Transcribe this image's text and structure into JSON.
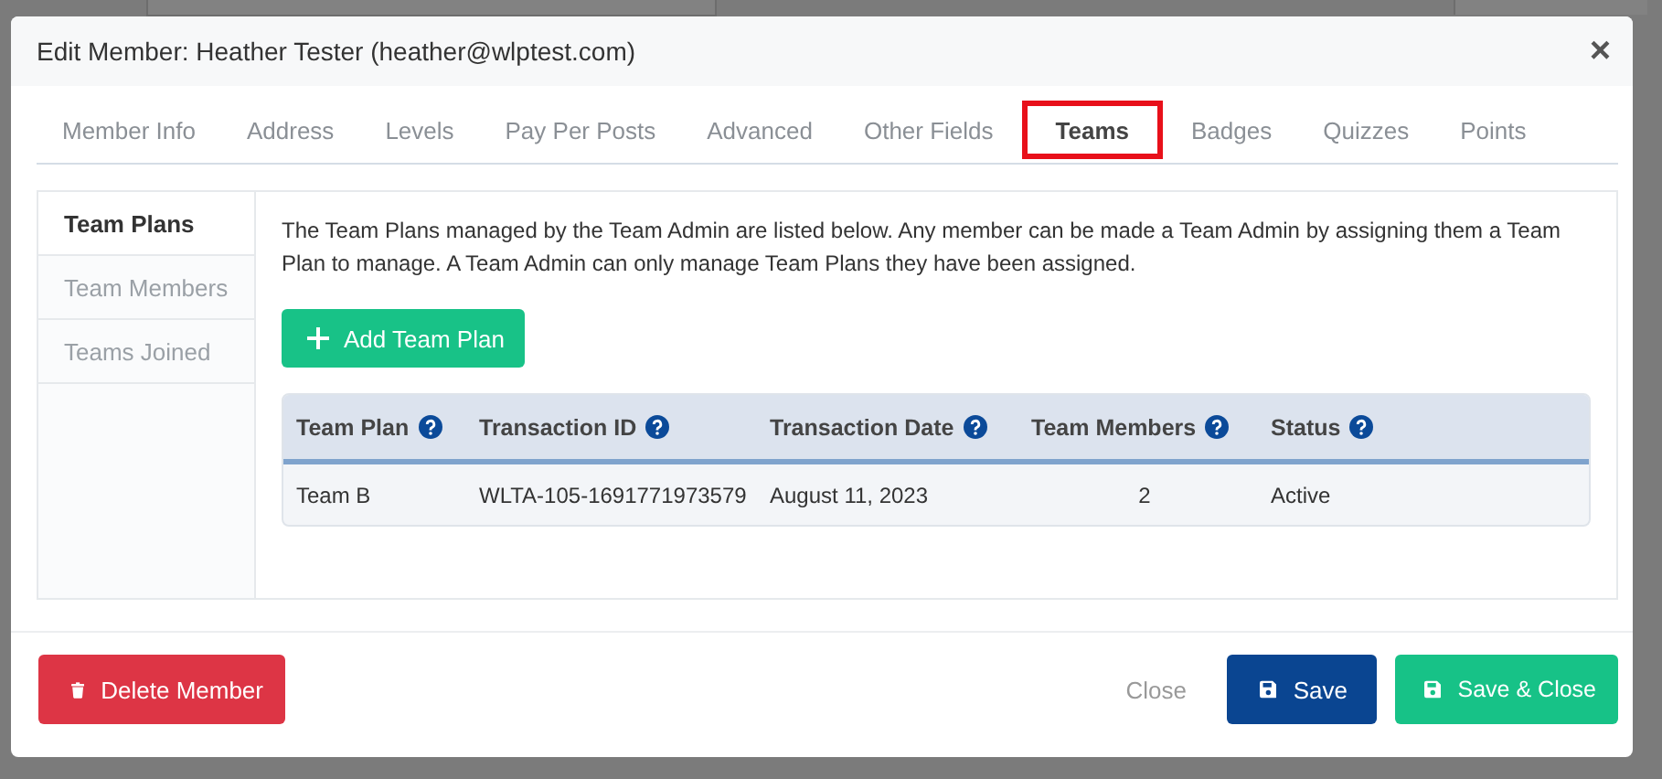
{
  "window": {
    "title": "Edit Member: Heather Tester (heather@wlptest.com)",
    "close": "×"
  },
  "tabs": [
    {
      "label": "Member Info",
      "selected": false,
      "highlighted": false
    },
    {
      "label": "Address",
      "selected": false,
      "highlighted": false
    },
    {
      "label": "Levels",
      "selected": false,
      "highlighted": false
    },
    {
      "label": "Pay Per Posts",
      "selected": false,
      "highlighted": false
    },
    {
      "label": "Advanced",
      "selected": false,
      "highlighted": false
    },
    {
      "label": "Other Fields",
      "selected": false,
      "highlighted": false
    },
    {
      "label": "Teams",
      "selected": true,
      "highlighted": true
    },
    {
      "label": "Badges",
      "selected": false,
      "highlighted": false
    },
    {
      "label": "Quizzes",
      "selected": false,
      "highlighted": false
    },
    {
      "label": "Points",
      "selected": false,
      "highlighted": false
    }
  ],
  "sidebar": {
    "items": [
      {
        "label": "Team Plans",
        "selected": true
      },
      {
        "label": "Team Members",
        "selected": false
      },
      {
        "label": "Teams Joined",
        "selected": false
      }
    ]
  },
  "content": {
    "description": "The Team Plans managed by the Team Admin are listed below. Any member can be made a Team Admin by assigning them a Team Plan to manage. A Team Admin can only manage Team Plans they have been assigned.",
    "add_button": "Add Team Plan",
    "table": {
      "columns": [
        "Team Plan",
        "Transaction ID",
        "Transaction Date",
        "Team Members",
        "Status"
      ],
      "rows": [
        [
          "Team B",
          "WLTA-105-1691771973579",
          "August 11, 2023",
          "2",
          "Active"
        ]
      ]
    }
  },
  "footer": {
    "buttons": [
      {
        "kind": "delete",
        "label": "Delete Member"
      },
      {
        "kind": "link",
        "label": "Close"
      },
      {
        "kind": "save",
        "label": "Save"
      },
      {
        "kind": "save-close",
        "label": "Save & Close"
      }
    ]
  }
}
